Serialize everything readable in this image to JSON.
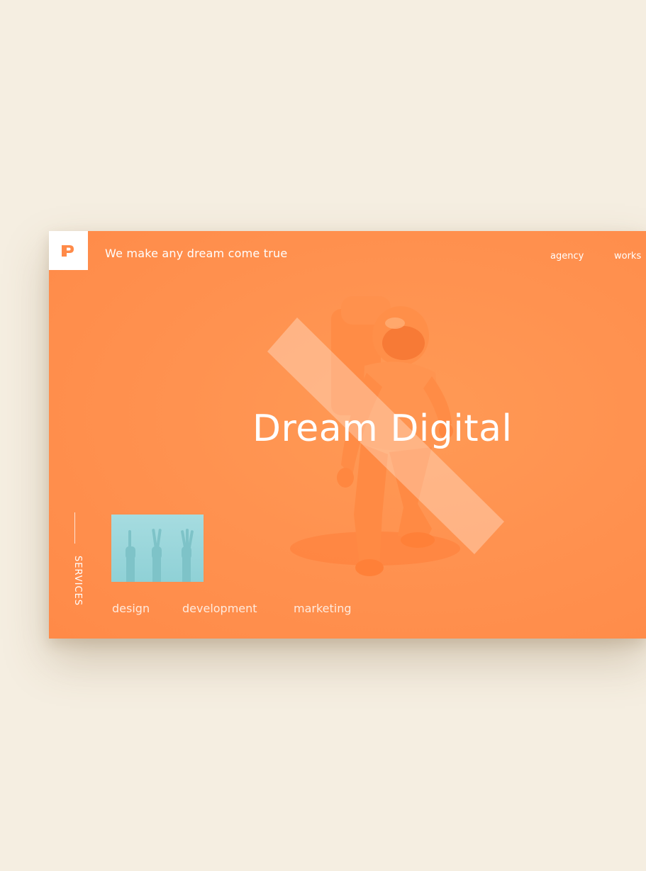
{
  "header": {
    "logo_text": "P",
    "tagline": "We make any dream come true",
    "nav": {
      "agency": "agency",
      "works": "works"
    }
  },
  "hero": {
    "headline": "Dream Digital",
    "image": "astronaut-figure"
  },
  "services": {
    "label": "SERVICES",
    "thumbnail": "peace-sign-hands-image",
    "items": [
      "design",
      "development",
      "marketing"
    ]
  },
  "colors": {
    "background": "#f5eee1",
    "accent_orange": "#ff9250",
    "thumb_blue": "#98d6da",
    "text": "#ffffff"
  }
}
